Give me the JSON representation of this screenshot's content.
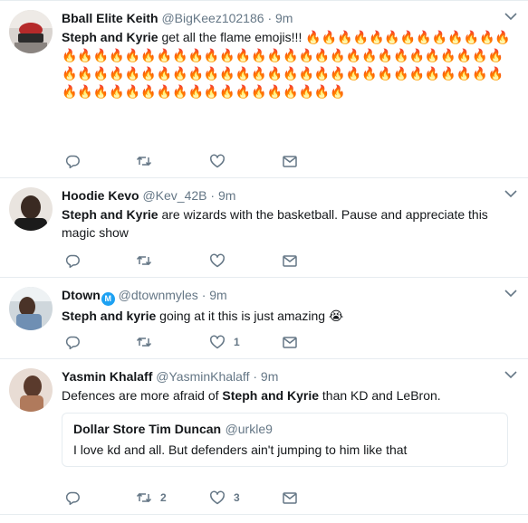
{
  "tweets": [
    {
      "name": "Bball Elite Keith",
      "handle": "@BigKeez102186",
      "time": "9m",
      "bold": "Steph and Kyrie",
      "rest": " get all the flame emojis!!! ",
      "fire_count": 87,
      "replies": "",
      "retweets": "",
      "likes": ""
    },
    {
      "name": "Hoodie Kevo",
      "handle": "@Kev_42B",
      "time": "9m",
      "bold": "Steph and Kyrie",
      "rest": " are wizards with the basketball. Pause and appreciate this magic show",
      "replies": "",
      "retweets": "",
      "likes": ""
    },
    {
      "name": "Dtown",
      "handle": "@dtownmyles",
      "time": "9m",
      "bold": "Steph and kyrie",
      "rest": " going at it this is just amazing ",
      "emoji": "😭",
      "replies": "",
      "retweets": "",
      "likes": "1"
    },
    {
      "name": "Yasmin Khalaff",
      "handle": "@YasminKhalaff",
      "time": "9m",
      "pre": "Defences are more afraid of ",
      "bold": "Steph and Kyrie",
      "rest": " than KD and LeBron.",
      "quote": {
        "name": "Dollar Store Tim Duncan",
        "handle": "@urkle9",
        "text": "I love kd and all. But defenders ain't jumping to him like that"
      },
      "replies": "",
      "retweets": "2",
      "likes": "3"
    }
  ],
  "fire_emoji": "🔥",
  "separator": "·",
  "verified_glyph": "M",
  "icons": [
    "reply-icon",
    "retweet-icon",
    "like-icon",
    "dm-icon",
    "caret-down-icon"
  ],
  "colors": {
    "name": "#14171a",
    "secondary": "#657786",
    "border": "#e6ecf0",
    "verified": "#1da1f2"
  }
}
